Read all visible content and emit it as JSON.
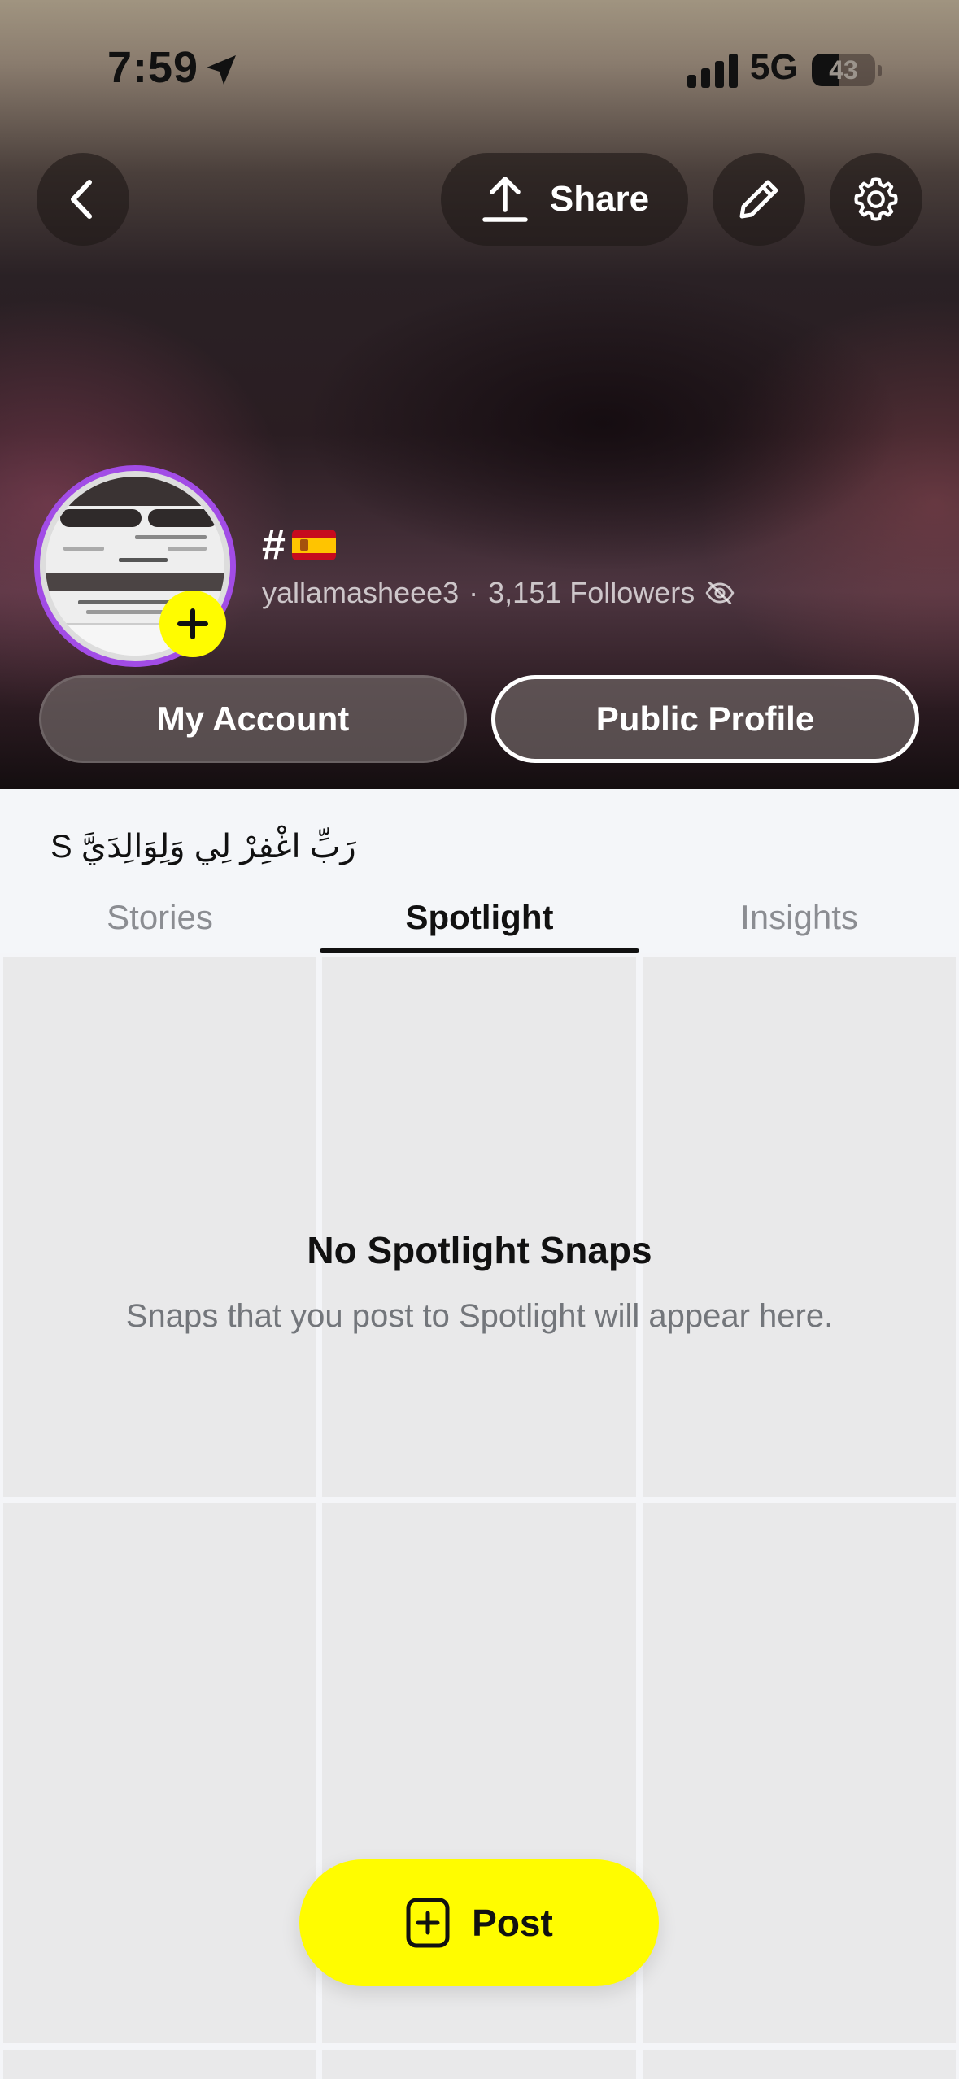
{
  "status_bar": {
    "time": "7:59",
    "network": "5G",
    "battery_percent": 43,
    "battery_label": "43"
  },
  "header": {
    "share_label": "Share",
    "icons": [
      "chevron-left-icon",
      "upload-icon",
      "pencil-icon",
      "gear-icon"
    ]
  },
  "profile": {
    "display_name": "#",
    "flag": "spain-flag",
    "username": "yallamasheee3",
    "separator": "·",
    "followers": "3,151 Followers",
    "visibility_icon": "eye-off-icon",
    "avatar_ring_color": "#a24ce6"
  },
  "buttons": {
    "my_account": "My Account",
    "public_profile": "Public Profile",
    "post": "Post"
  },
  "bio": "S   رَبِّ اغْفِرْ لِي وَلِوَالِدَيَّ",
  "tabs": [
    {
      "label": "Stories",
      "active": false
    },
    {
      "label": "Spotlight",
      "active": true
    },
    {
      "label": "Insights",
      "active": false
    }
  ],
  "empty_state": {
    "title": "No Spotlight Snaps",
    "description": "Snaps that you post to Spotlight will appear here."
  },
  "colors": {
    "accent_yellow": "#fffc00",
    "text_primary": "#111111",
    "text_secondary": "#73767b"
  }
}
